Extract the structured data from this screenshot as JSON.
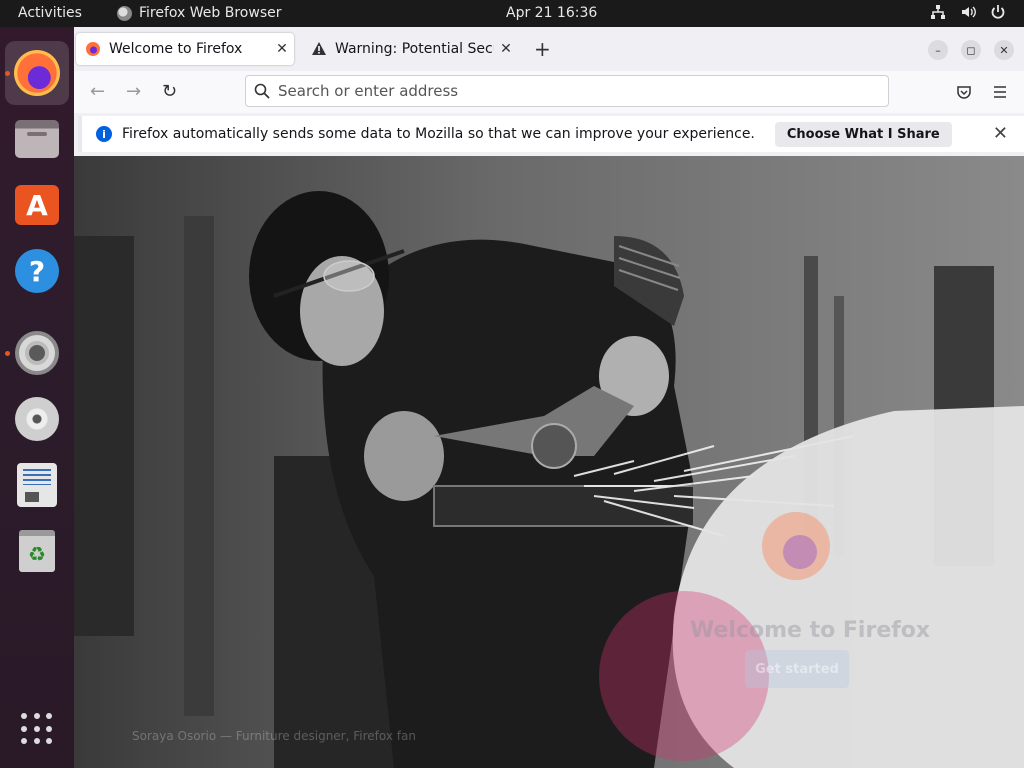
{
  "topbar": {
    "activities": "Activities",
    "app_name": "Firefox Web Browser",
    "clock": "Apr 21  16:36"
  },
  "dock": {
    "items": [
      "firefox",
      "files",
      "software-store",
      "help",
      "settings",
      "disc",
      "text-editor",
      "trash",
      "show-apps"
    ]
  },
  "browser": {
    "tabs": [
      {
        "title": "Welcome to Firefox",
        "active": true
      },
      {
        "title": "Warning: Potential Securi",
        "active": false
      }
    ],
    "url_placeholder": "Search or enter address",
    "notification": {
      "text": "Firefox automatically sends some data to Mozilla so that we can improve your experience.",
      "button": "Choose What I Share"
    }
  },
  "page": {
    "welcome_title": "Welcome to Firefox",
    "get_started": "Get started",
    "caption": "Soraya Osorio — Furniture designer, Firefox fan"
  },
  "colors": {
    "accent": "#e95420",
    "firefox_blue": "#0060df"
  }
}
